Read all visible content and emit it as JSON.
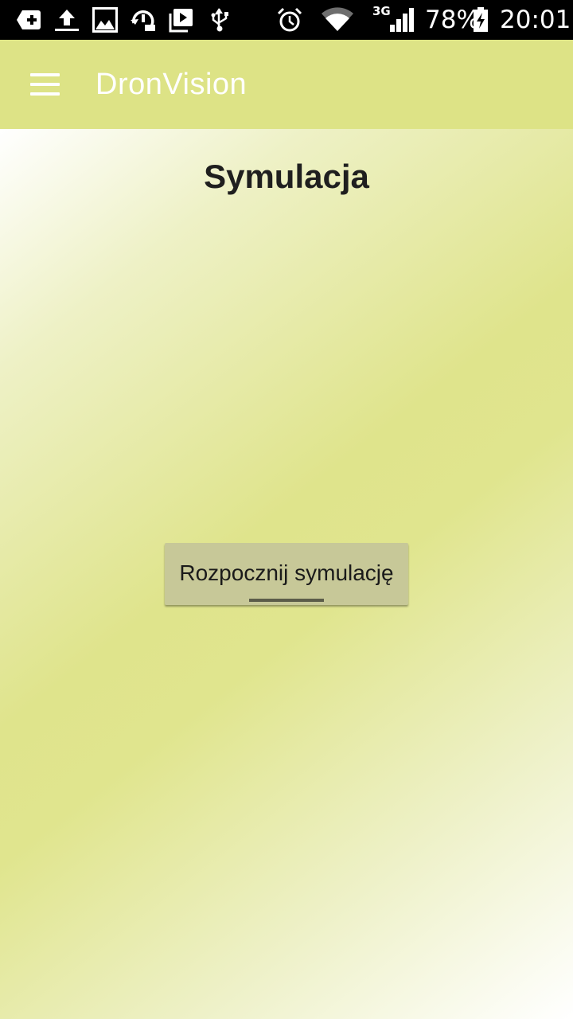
{
  "status_bar": {
    "network": "3G",
    "battery": "78%",
    "time": "20:01",
    "icons": [
      "notification-plus-icon",
      "upload-icon",
      "image-icon",
      "sync-icon",
      "media-icon",
      "usb-icon",
      "alarm-icon",
      "wifi-icon",
      "signal-icon",
      "battery-charging-icon"
    ]
  },
  "app_bar": {
    "title": "DronVision",
    "menu_icon": "hamburger-menu-icon",
    "background": "#dde386"
  },
  "main": {
    "title": "Symulacja",
    "start_button_label": "Rozpocznij symulację"
  }
}
